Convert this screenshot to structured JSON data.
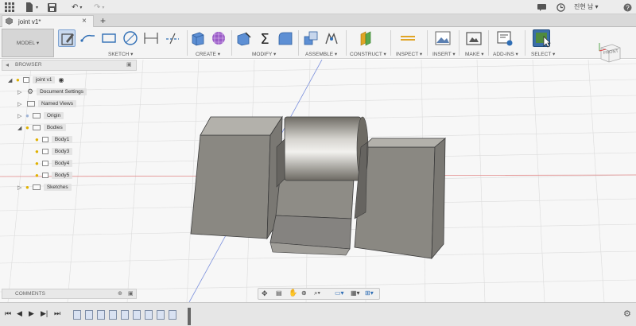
{
  "app": {
    "user_label": "진현 남",
    "colors": {
      "accent_blue": "#2f6eb5",
      "ribbon_bg": "#f4f4f4",
      "viewport_bg": "#f7f7f7"
    }
  },
  "tab": {
    "label": "joint v1*",
    "icon": "cube-doc-icon"
  },
  "toolbar": {
    "workspace": "MODEL",
    "groups": [
      "SKETCH",
      "CREATE",
      "MODIFY",
      "ASSEMBLE",
      "CONSTRUCT",
      "INSPECT",
      "INSERT",
      "MAKE",
      "ADD-INS",
      "SELECT"
    ]
  },
  "viewcube": {
    "face_label": "FRONT"
  },
  "browser": {
    "title": "BROWSER",
    "root": "joint v1",
    "items": [
      {
        "label": "Document Settings"
      },
      {
        "label": "Named Views"
      },
      {
        "label": "Origin"
      },
      {
        "label": "Bodies"
      },
      {
        "label": "Body1"
      },
      {
        "label": "Body3"
      },
      {
        "label": "Body4"
      },
      {
        "label": "Body5"
      },
      {
        "label": "Sketches"
      }
    ]
  },
  "comments": {
    "title": "COMMENTS"
  },
  "timeline": {
    "feature_count": 9
  }
}
